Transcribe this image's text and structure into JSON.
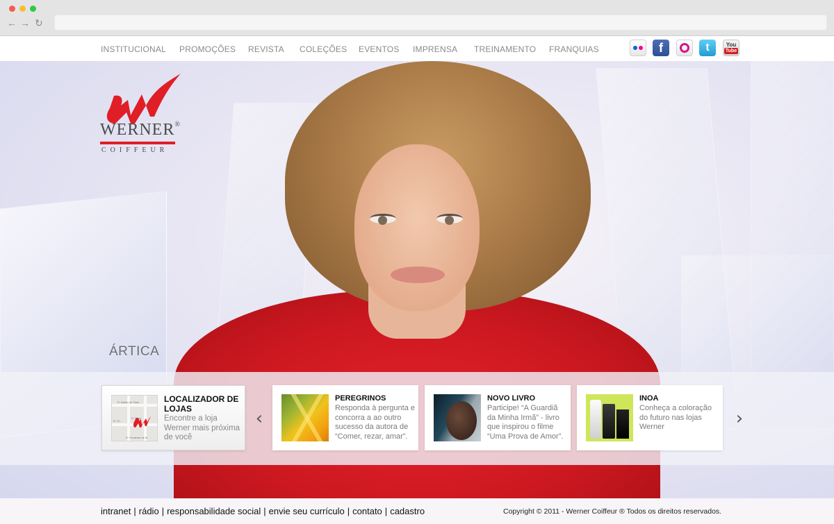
{
  "nav": {
    "items": [
      "INSTITUCIONAL",
      "PROMOÇÕES",
      "REVISTA",
      "COLEÇÕES",
      "EVENTOS",
      "IMPRENSA",
      "TREINAMENTO",
      "FRANQUIAS"
    ]
  },
  "social": {
    "facebook_glyph": "f",
    "twitter_glyph": "t",
    "youtube_top": "You",
    "youtube_bottom": "Tube"
  },
  "brand": {
    "name": "WERNER",
    "mark": "®",
    "sub": "COIFFEUR",
    "primary_color": "#e01e26"
  },
  "hero": {
    "collection": "ÁRTICA"
  },
  "store_locator": {
    "title": "LOCALIZADOR DE LOJAS",
    "text": "Encontre a loja Werner mais próxima de você",
    "map_labels": [
      "R. Barão de Tatuí",
      "R. Piauí",
      "R. Pr...",
      "R. Prudente de M"
    ]
  },
  "cards": [
    {
      "title": "PEREGRINOS",
      "text": "Responda à pergunta e concorra a ao outro sucesso da autora de “Comer, rezar, amar”."
    },
    {
      "title": "NOVO LIVRO",
      "text": "Participe! “A Guardiã da Minha Irmã” - livro que inspirou o filme “Uma Prova de Amor”."
    },
    {
      "title": "INOA",
      "text": "Conheça a coloração do futuro nas lojas Werner"
    }
  ],
  "carousel": {
    "prev": "‹",
    "next": "›"
  },
  "footer": {
    "links": [
      "intranet",
      "rádio",
      "responsabilidade social",
      "envie seu currículo",
      "contato",
      "cadastro"
    ],
    "separator": "|",
    "copyright": "Copyright © 2011 - Werner Coiffeur ® Todos os direitos reservados."
  }
}
